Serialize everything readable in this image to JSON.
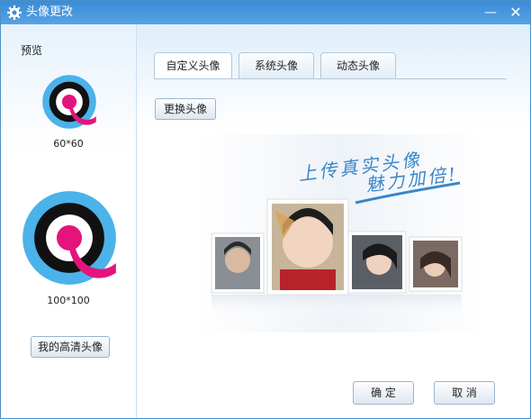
{
  "window": {
    "title": "头像更改",
    "minimize_label": "—",
    "close_label": "✕"
  },
  "preview": {
    "label": "预览",
    "small_size": "60*60",
    "large_size": "100*100",
    "hd_button": "我的高清头像"
  },
  "tabs": [
    {
      "label": "自定义头像"
    },
    {
      "label": "系统头像"
    },
    {
      "label": "动态头像"
    }
  ],
  "custom": {
    "change_button": "更换头像",
    "banner_line1": "上传真实头像",
    "banner_line2": "魅力加倍!"
  },
  "footer": {
    "ok_button": "确 定",
    "cancel_button": "取 消"
  },
  "colors": {
    "accent": "#3a86c8",
    "logo_blue": "#4bb2ea",
    "logo_pink": "#e4147d"
  }
}
